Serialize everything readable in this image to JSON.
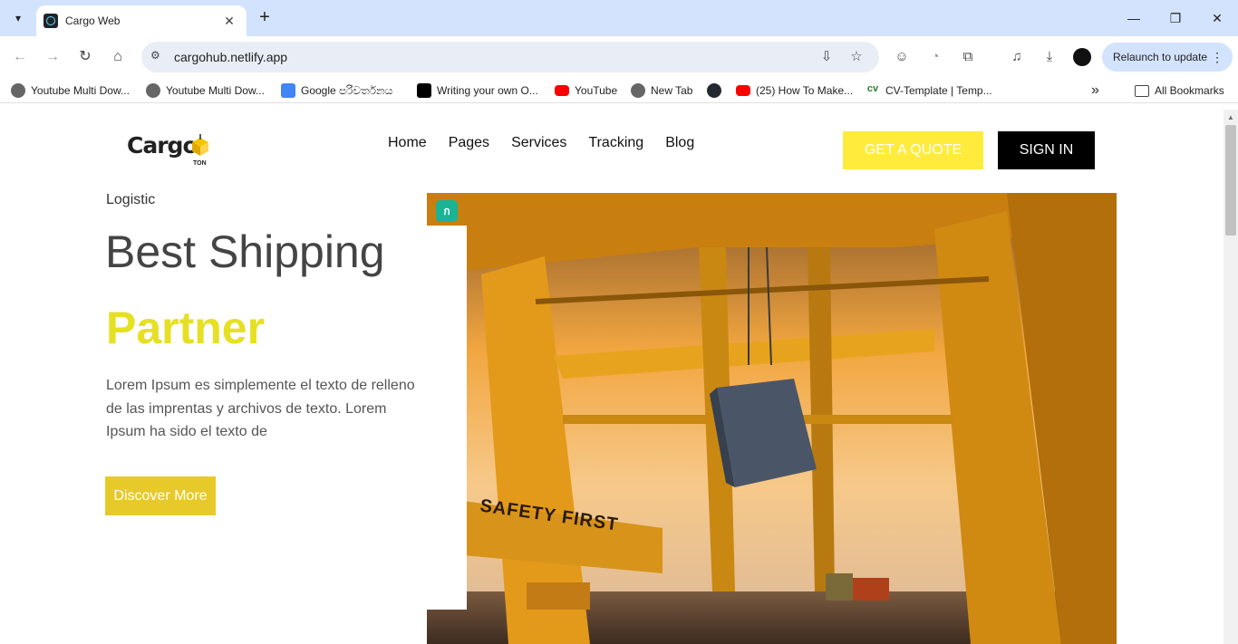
{
  "browser": {
    "tab": {
      "title": "Cargo Web",
      "close_glyph": "✕"
    },
    "new_tab_glyph": "+",
    "window_controls": {
      "minimize": "—",
      "restore": "❐",
      "close": "✕"
    },
    "url": "cargohub.netlify.app",
    "relaunch_label": "Relaunch to update",
    "bookmarks": [
      {
        "label": "Youtube Multi Dow...",
        "icon": "globe-icon"
      },
      {
        "label": "Youtube Multi Dow...",
        "icon": "globe-icon"
      },
      {
        "label": "Google පරිවර්තනය",
        "icon": "google-translate-icon"
      },
      {
        "label": "Writing your own O...",
        "icon": "medium-icon"
      },
      {
        "label": "YouTube",
        "icon": "youtube-icon"
      },
      {
        "label": "New Tab",
        "icon": "globe-icon"
      },
      {
        "label": "",
        "icon": "github-icon"
      },
      {
        "label": "(25) How To Make...",
        "icon": "youtube-icon"
      },
      {
        "label": "CV-Template | Temp...",
        "icon": "cv-icon"
      }
    ],
    "overflow_glyph": "»",
    "all_bookmarks_label": "All Bookmarks"
  },
  "site": {
    "logo": {
      "word": "Cargo",
      "sub": "TON"
    },
    "nav": [
      "Home",
      "Pages",
      "Services",
      "Tracking",
      "Blog"
    ],
    "quote_label": "GET A QUOTE",
    "signin_label": "SIGN IN",
    "hero": {
      "eyebrow": "Logistic",
      "title": "Best Shipping",
      "highlight": "Partner",
      "lead": "Lorem Ipsum es simplemente el texto de relleno de las imprentas y archivos de texto. Lorem Ipsum ha sido el texto de",
      "cta_label": "Discover More",
      "image_sign_text": "SAFETY FIRST"
    }
  },
  "colors": {
    "accent_yellow": "#ffeb3b",
    "cta_yellow": "#e8c92a",
    "highlight_yellow": "#e6e024",
    "tabstrip": "#d3e3fd"
  }
}
